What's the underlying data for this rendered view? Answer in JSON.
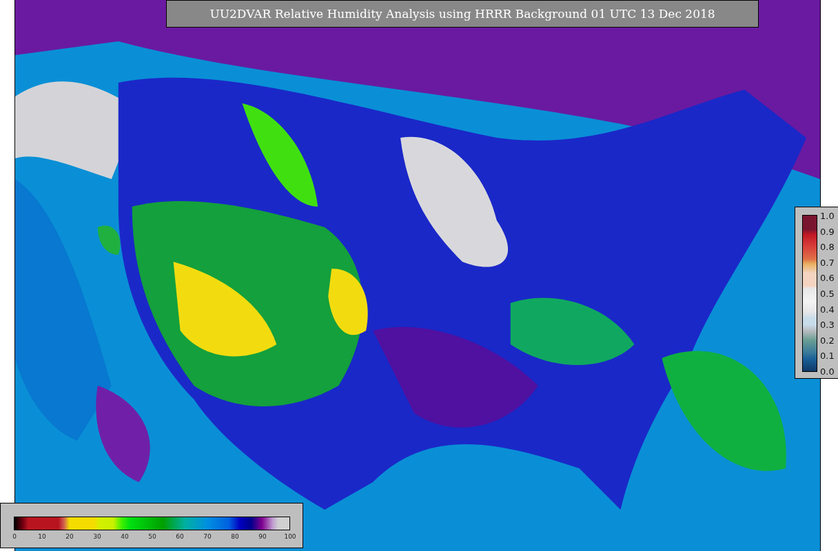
{
  "title": "UU2DVAR Relative Humidity Analysis using HRRR Background 01 UTC 13 Dec 2018",
  "vertical_colorbar": {
    "ticks": [
      "1.0",
      "0.9",
      "0.8",
      "0.7",
      "0.6",
      "0.5",
      "0.4",
      "0.3",
      "0.2",
      "0.1",
      "0.0"
    ]
  },
  "horizontal_colorbar": {
    "ticks": [
      "0",
      "10",
      "20",
      "30",
      "40",
      "50",
      "60",
      "70",
      "80",
      "90",
      "100"
    ]
  }
}
